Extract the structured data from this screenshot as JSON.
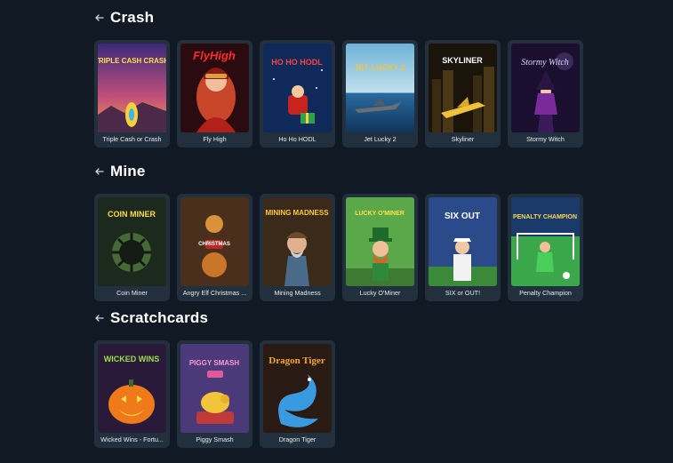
{
  "sections": [
    {
      "title": "Crash",
      "games": [
        {
          "label": "Triple Cash or Crash",
          "art_text": "TRIPLE CASH CRASH",
          "art": "rocket"
        },
        {
          "label": "Fly High",
          "art_text": "FlyHigh",
          "art": "pilot"
        },
        {
          "label": "Ho Ho HODL",
          "art_text": "HO HO HODL",
          "art": "santa"
        },
        {
          "label": "Jet Lucky 2",
          "art_text": "JET LUCKY 2",
          "art": "jet"
        },
        {
          "label": "Skyliner",
          "art_text": "SKYLINER",
          "art": "city"
        },
        {
          "label": "Stormy Witch",
          "art_text": "Stormy Witch",
          "art": "witch"
        }
      ]
    },
    {
      "title": "Mine",
      "games": [
        {
          "label": "Coin Miner",
          "art_text": "COIN MINER",
          "art": "mine"
        },
        {
          "label": "Angry Elf Christmas ...",
          "art_text": "CHRISTMAS",
          "art": "elf"
        },
        {
          "label": "Mining Madness",
          "art_text": "MINING MADNESS",
          "art": "miner"
        },
        {
          "label": "Lucky O'Miner",
          "art_text": "LUCKY O'MINER",
          "art": "leprechaun"
        },
        {
          "label": "SIX or OUT!",
          "art_text": "SIX OUT",
          "art": "cricket"
        },
        {
          "label": "Penalty Champion",
          "art_text": "PENALTY CHAMPION",
          "art": "football"
        }
      ]
    },
    {
      "title": "Scratchcards",
      "games": [
        {
          "label": "Wicked Wins - Fortu...",
          "art_text": "WICKED WINS",
          "art": "pumpkin"
        },
        {
          "label": "Piggy Smash",
          "art_text": "PIGGY SMASH",
          "art": "piggy"
        },
        {
          "label": "Dragon Tiger",
          "art_text": "Dragon Tiger",
          "art": "dragon"
        }
      ]
    }
  ]
}
